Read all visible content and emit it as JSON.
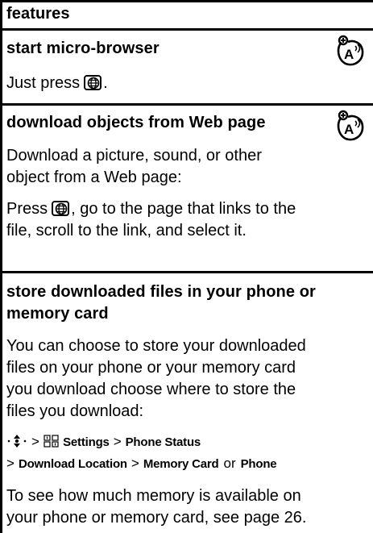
{
  "header": "features",
  "sections": [
    {
      "title": "start micro-browser",
      "icon": "network-service-icon",
      "paragraphs": [
        "Just press",
        "."
      ]
    },
    {
      "title": "download objects from Web page",
      "icon": "network-service-icon",
      "lines": [
        "Download a picture, sound, or other",
        "object from a Web page:",
        "Press",
        ", go to the page that links to the",
        "file, scroll to the link, and select it."
      ]
    },
    {
      "title_lines": [
        "store downloaded files in your phone or",
        "memory card"
      ],
      "body_lines": [
        "You can choose to store your downloaded",
        "files on your phone or your memory card",
        "you download choose where to store the",
        "files you download:"
      ],
      "path": {
        "settings": "Settings",
        "phone_status": "Phone Status",
        "download_location": "Download Location",
        "memory_card": "Memory Card",
        "or": "or",
        "phone": "Phone"
      },
      "footer_lines": [
        "To see how much memory is available on",
        "your phone or memory card, see page 26."
      ]
    }
  ]
}
